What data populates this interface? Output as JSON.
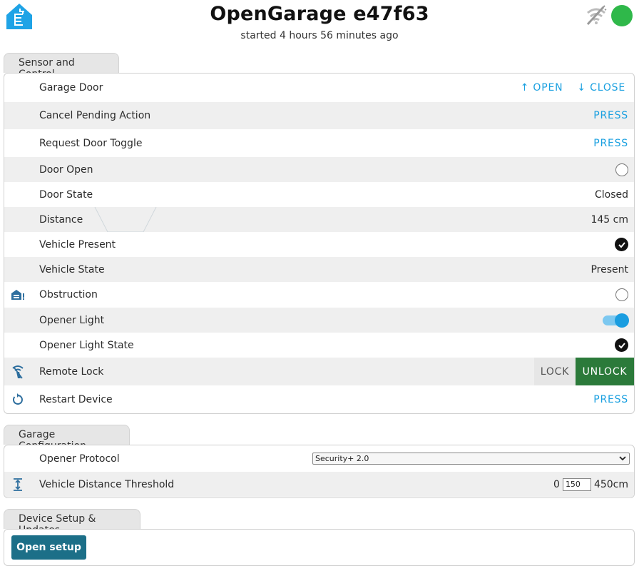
{
  "header": {
    "title": "OpenGarage e47f63",
    "subtitle": "started 4 hours 56 minutes ago",
    "status_color": "#2fb84a",
    "logo_icon": "home-assistant-esphome-logo",
    "network_icon": "wifi-off-icon"
  },
  "sensor_section": {
    "tab_label": "Sensor and Control",
    "garage_door": {
      "label": "Garage Door",
      "open_label": "↑ OPEN",
      "close_label": "↓ CLOSE"
    },
    "cancel_pending": {
      "label": "Cancel Pending Action",
      "button": "PRESS"
    },
    "request_toggle": {
      "label": "Request Door Toggle",
      "button": "PRESS"
    },
    "door_open": {
      "label": "Door Open",
      "state": false
    },
    "door_state": {
      "label": "Door State",
      "value": "Closed"
    },
    "distance": {
      "label": "Distance",
      "value": "145 cm"
    },
    "vehicle_present": {
      "label": "Vehicle Present",
      "state": true
    },
    "vehicle_state": {
      "label": "Vehicle State",
      "value": "Present"
    },
    "obstruction": {
      "label": "Obstruction",
      "state": false
    },
    "opener_light": {
      "label": "Opener Light",
      "state": true
    },
    "opener_light_state": {
      "label": "Opener Light State",
      "state": true
    },
    "remote_lock": {
      "label": "Remote Lock",
      "lock_label": "LOCK",
      "unlock_label": "UNLOCK"
    },
    "restart": {
      "label": "Restart Device",
      "button": "PRESS"
    }
  },
  "config_section": {
    "tab_label": "Garage Configuration",
    "opener_protocol": {
      "label": "Opener Protocol",
      "selected": "Security+ 2.0"
    },
    "threshold": {
      "label": "Vehicle Distance Threshold",
      "min": "0",
      "value": "150",
      "max": "450cm"
    }
  },
  "setup_section": {
    "tab_label": "Device Setup & Updates",
    "button": "Open setup"
  },
  "colors": {
    "accent": "#1aa0e0",
    "unlock": "#2b7a3a",
    "primary": "#1c6f88"
  }
}
